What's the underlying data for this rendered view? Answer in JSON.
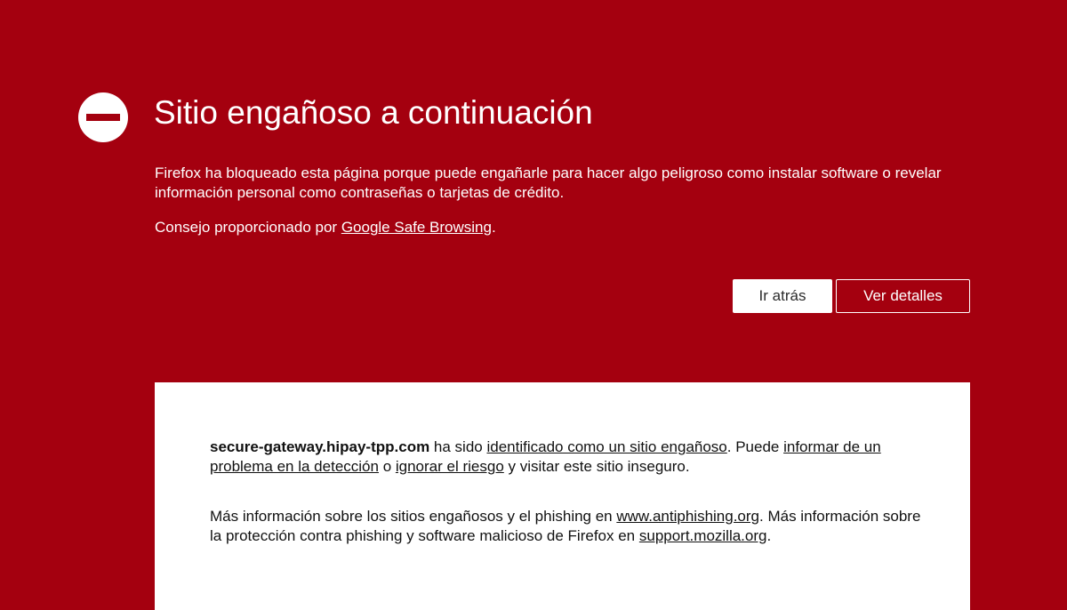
{
  "header": {
    "title": "Sitio engañoso a continuación",
    "description": "Firefox ha bloqueado esta página porque puede engañarle para hacer algo peligroso como instalar software o revelar información personal como contraseñas o tarjetas de crédito.",
    "advisory_prefix": "Consejo proporcionado por ",
    "advisory_link": "Google Safe Browsing",
    "advisory_suffix": "."
  },
  "buttons": {
    "back": "Ir atrás",
    "details": "Ver detalles"
  },
  "details": {
    "site": "secure-gateway.hipay-tpp.com",
    "text1": " ha sido ",
    "link_identified": "identificado como un sitio engañoso",
    "text2": ". Puede ",
    "link_report": "informar de un problema en la detección",
    "text3": " o ",
    "link_ignore": "ignorar el riesgo",
    "text4": " y visitar este sitio inseguro.",
    "more_text1": "Más información sobre los sitios engañosos y el phishing en ",
    "link_antiphishing": "www.antiphishing.org",
    "more_text2": ". Más información sobre la protección contra phishing y software malicioso de Firefox en ",
    "link_support": "support.mozilla.org",
    "more_text3": "."
  },
  "icons": {
    "warning": "stop-icon"
  },
  "colors": {
    "background": "#a4000f",
    "panel": "#ffffff",
    "text_light": "#ffffff",
    "text_dark": "#111111"
  }
}
